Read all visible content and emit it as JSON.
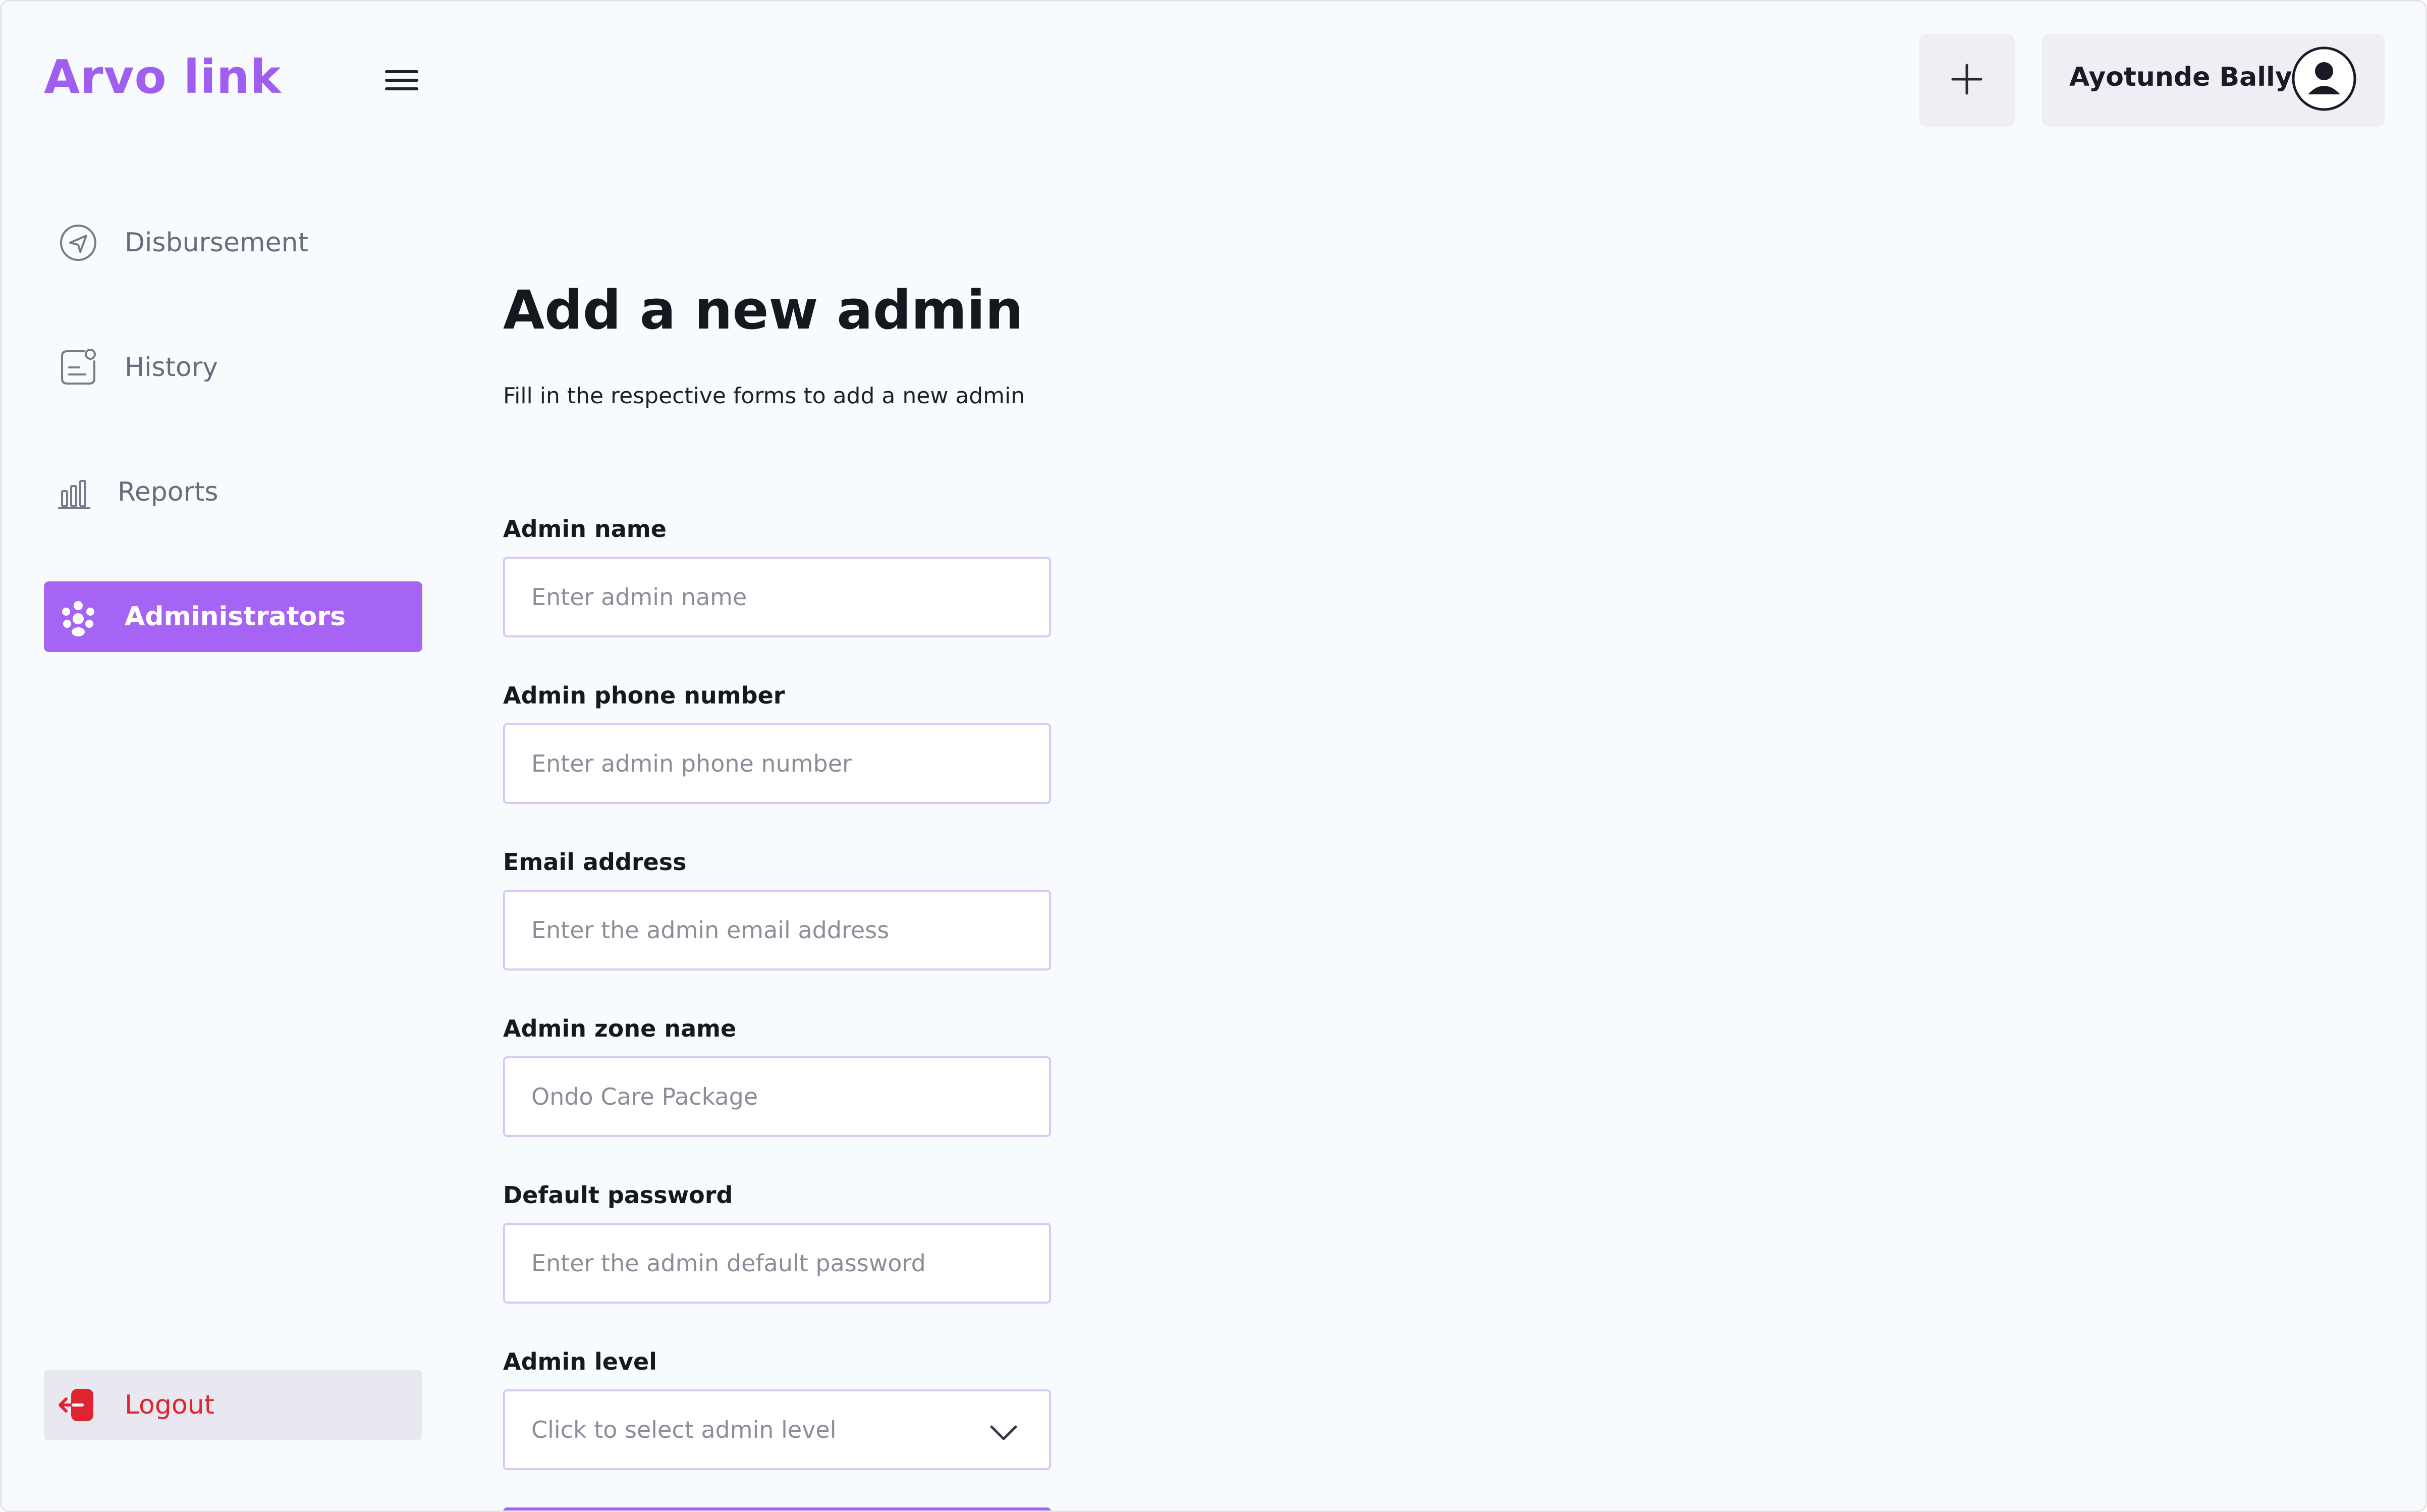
{
  "app": {
    "brand": "Arvo link"
  },
  "header": {
    "user_name": "Ayotunde Bally"
  },
  "sidebar": {
    "items": [
      {
        "label": "Disbursement",
        "icon": "send-icon"
      },
      {
        "label": "History",
        "icon": "history-icon"
      },
      {
        "label": "Reports",
        "icon": "bar-chart-icon"
      },
      {
        "label": "Administrators",
        "icon": "users-icon",
        "active": true
      }
    ],
    "logout": {
      "label": "Logout",
      "icon": "logout-icon"
    }
  },
  "main": {
    "title": "Add a new admin",
    "subtitle": "Fill in the respective forms to add a new admin",
    "fields": [
      {
        "label": "Admin name",
        "placeholder": "Enter admin name"
      },
      {
        "label": "Admin phone number",
        "placeholder": "Enter admin phone number"
      },
      {
        "label": "Email address",
        "placeholder": "Enter the admin email address"
      },
      {
        "label": "Admin zone name",
        "placeholder": "Ondo Care Package"
      },
      {
        "label": "Default password",
        "placeholder": "Enter the admin default password"
      },
      {
        "label": "Admin level",
        "placeholder": "Click to select admin level"
      }
    ]
  },
  "colors": {
    "accent": "#a664f5",
    "brand": "#a05ef0",
    "danger": "#e0242f",
    "background": "#f8fbfe"
  }
}
